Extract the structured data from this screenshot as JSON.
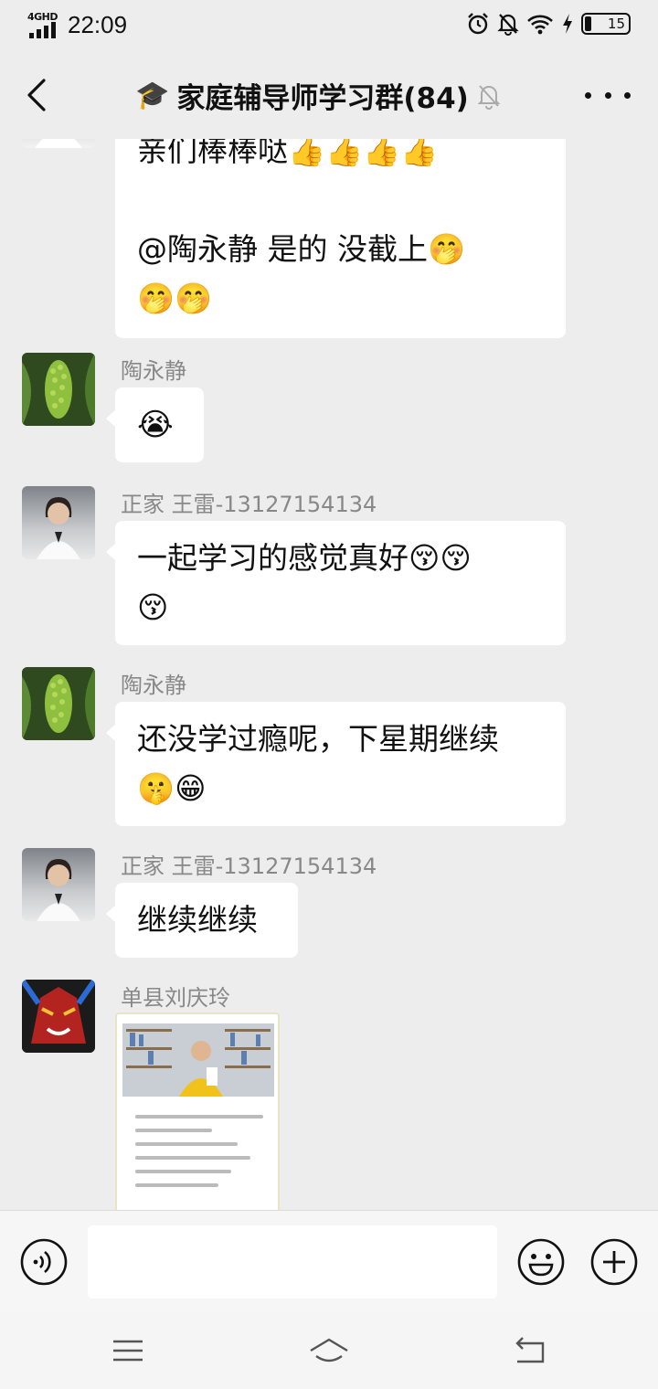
{
  "status_bar": {
    "network": "4GHD",
    "time": "22:09",
    "battery": "15",
    "battery_level": 0.15
  },
  "nav": {
    "title": "家庭辅导师学习群(84)",
    "title_emoji": "🎓",
    "icons": [
      "back-arrow-icon",
      "muted-bell-icon",
      "more-icon"
    ]
  },
  "messages": [
    {
      "lines": [
        "亲们棒棒哒👍👍👍👍",
        "",
        "@陶永静  是的  没截上🤭",
        "🤭🤭"
      ]
    },
    {
      "sender": "陶永静",
      "text": "😭"
    },
    {
      "sender": "正家 王雷-13127154134",
      "lines": [
        "一起学习的感觉真好😚😚",
        "😚"
      ]
    },
    {
      "sender": "陶永静",
      "lines": [
        "还没学过瘾呢，下星期继续",
        "🤫😁"
      ]
    },
    {
      "sender": "正家 王雷-13127154134",
      "text": "继续继续"
    },
    {
      "sender": "单县刘庆玲",
      "image": "book-quote-image"
    }
  ],
  "input_bar": {
    "placeholder": "",
    "icons": [
      "voice-icon",
      "emoji-icon",
      "plus-icon"
    ]
  },
  "system_nav": {
    "icons": [
      "menu-icon",
      "home-icon",
      "back-icon"
    ]
  }
}
